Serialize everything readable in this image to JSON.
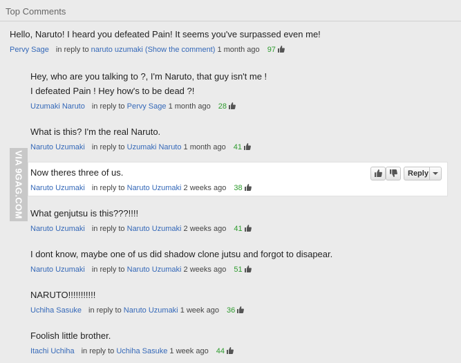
{
  "header": {
    "title": "Top Comments"
  },
  "watermark": "VIA 9GAG.COM",
  "reply_button_label": "Reply",
  "comments": [
    {
      "text": [
        "Hello, Naruto! I heard you defeated Pain! It seems you've surpassed even me!"
      ],
      "author": "Pervy Sage",
      "in_reply_to": "in reply to",
      "target": "naruto uzumaki",
      "show": "(Show the comment)",
      "time": "1 month ago",
      "likes": "97"
    },
    {
      "text": [
        "Hey, who are you talking to ?, I'm Naruto, that guy isn't me !",
        "I defeated Pain ! Hey how's to be dead ?!"
      ],
      "author": "Uzumaki Naruto",
      "in_reply_to": "in reply to",
      "target": "Pervy Sage",
      "time": "1 month ago",
      "likes": "28"
    },
    {
      "text": [
        "What is this? I'm the real Naruto."
      ],
      "author": "Naruto Uzumaki",
      "in_reply_to": "in reply to",
      "target": "Uzumaki Naruto",
      "time": "1 month ago",
      "likes": "41"
    },
    {
      "text": [
        "Now theres three of us."
      ],
      "author": "Naruto Uzumaki",
      "in_reply_to": "in reply to",
      "target": "Naruto Uzumaki",
      "time": "2 weeks ago",
      "likes": "38"
    },
    {
      "text": [
        "What genjutsu is this???!!!!"
      ],
      "author": "Naruto Uzumaki",
      "in_reply_to": "in reply to",
      "target": "Naruto Uzumaki",
      "time": "2 weeks ago",
      "likes": "41"
    },
    {
      "text": [
        "I dont know, maybe one of us did shadow clone jutsu and forgot to disapear."
      ],
      "author": "Naruto Uzumaki",
      "in_reply_to": "in reply to",
      "target": "Naruto Uzumaki",
      "time": "2 weeks ago",
      "likes": "51"
    },
    {
      "text": [
        "NARUTO!!!!!!!!!!!"
      ],
      "author": "Uchiha Sasuke",
      "in_reply_to": "in reply to",
      "target": "Naruto Uzumaki",
      "time": "1 week ago",
      "likes": "36"
    },
    {
      "text": [
        "Foolish little brother."
      ],
      "author": "Itachi Uchiha",
      "in_reply_to": "in reply to",
      "target": "Uchiha Sasuke",
      "time": "1 week ago",
      "likes": "44"
    }
  ]
}
